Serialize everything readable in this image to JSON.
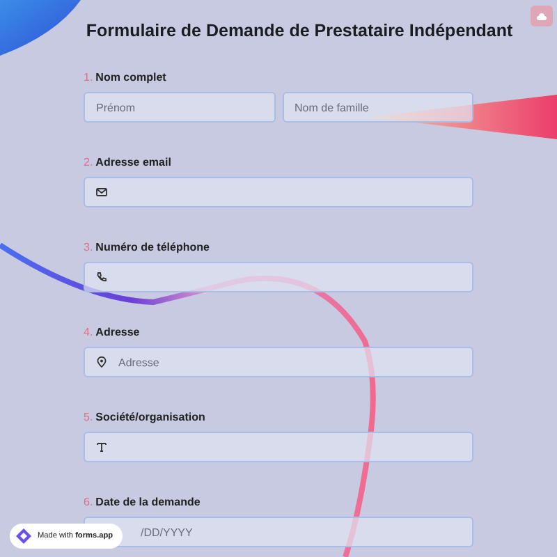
{
  "title": "Formulaire de Demande de Prestataire Indépendant",
  "questions": [
    {
      "number": "1.",
      "label": "Nom complet",
      "kind": "name",
      "inputs": [
        {
          "placeholder": "Prénom"
        },
        {
          "placeholder": "Nom de famille"
        }
      ]
    },
    {
      "number": "2.",
      "label": "Adresse email",
      "kind": "email"
    },
    {
      "number": "3.",
      "label": "Numéro de téléphone",
      "kind": "phone"
    },
    {
      "number": "4.",
      "label": "Adresse",
      "kind": "address",
      "placeholder": "Adresse"
    },
    {
      "number": "5.",
      "label": "Société/organisation",
      "kind": "text"
    },
    {
      "number": "6.",
      "label": "Date de la demande",
      "kind": "date",
      "placeholder": "/DD/YYYY"
    }
  ],
  "badge": {
    "text": "Made with **forms.app**"
  }
}
